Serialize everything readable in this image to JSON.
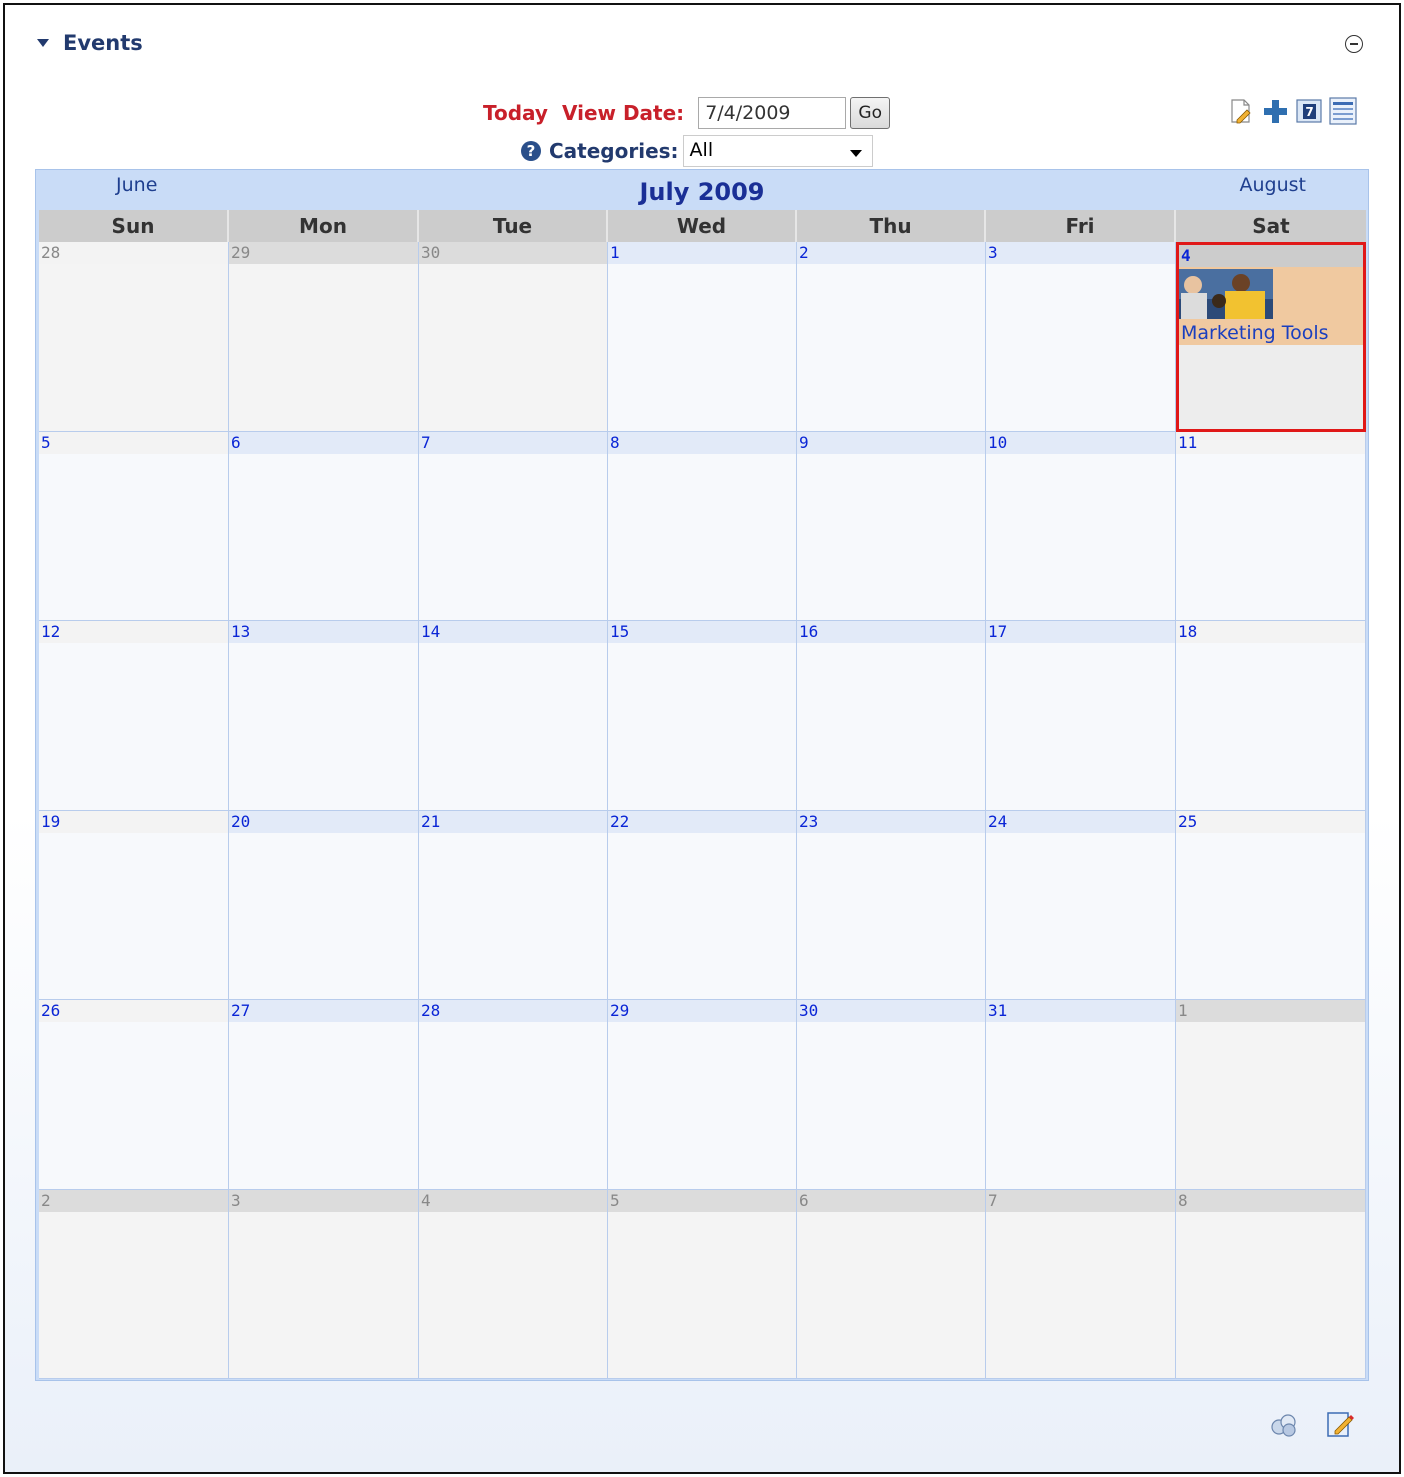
{
  "portlet": {
    "title": "Events"
  },
  "toolbar": {
    "today_label": "Today",
    "view_date_label": "View Date:",
    "view_date_value": "7/4/2009",
    "go_label": "Go",
    "categories_label": "Categories:",
    "categories_value": "All"
  },
  "view_icons": [
    "add-event-icon",
    "plus-icon",
    "month-view-icon",
    "list-view-icon"
  ],
  "calendar": {
    "prev_month": "June",
    "title": "July 2009",
    "next_month": "August",
    "weekdays": [
      "Sun",
      "Mon",
      "Tue",
      "Wed",
      "Thu",
      "Fri",
      "Sat"
    ],
    "weeks": [
      [
        "28",
        "29",
        "30",
        "1",
        "2",
        "3",
        "4"
      ],
      [
        "5",
        "6",
        "7",
        "8",
        "9",
        "10",
        "11"
      ],
      [
        "12",
        "13",
        "14",
        "15",
        "16",
        "17",
        "18"
      ],
      [
        "19",
        "20",
        "21",
        "22",
        "23",
        "24",
        "25"
      ],
      [
        "26",
        "27",
        "28",
        "29",
        "30",
        "31",
        "1"
      ],
      [
        "2",
        "3",
        "4",
        "5",
        "6",
        "7",
        "8"
      ]
    ],
    "event": {
      "label": "Marketing Tools"
    }
  },
  "colors": {
    "accent": "#223a6e",
    "today": "#c8202a",
    "selected_border": "#e01818",
    "event_bg": "#f0c9a0"
  }
}
